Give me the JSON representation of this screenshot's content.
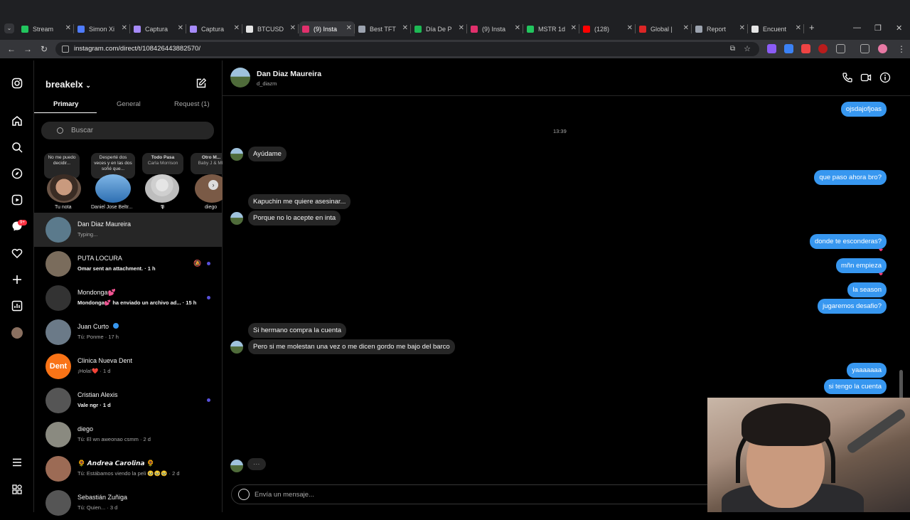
{
  "browser": {
    "tabs": [
      {
        "title": "Stream",
        "color": "#22c55e"
      },
      {
        "title": "Simon Xi",
        "color": "#4f7cff"
      },
      {
        "title": "Captura",
        "color": "#a78bfa"
      },
      {
        "title": "Captura",
        "color": "#a78bfa"
      },
      {
        "title": "BTCUSD",
        "color": "#e5e5e5"
      },
      {
        "title": "(9) Insta",
        "color": "#e1306c"
      },
      {
        "title": "Best TFT",
        "color": "#9ca3af"
      },
      {
        "title": "Día De P",
        "color": "#1db954"
      },
      {
        "title": "(9) Insta",
        "color": "#e1306c"
      },
      {
        "title": "MSTR 1d",
        "color": "#22c55e"
      },
      {
        "title": "(128)",
        "color": "#ff0000"
      },
      {
        "title": "Global |",
        "color": "#dc2626"
      },
      {
        "title": "Report",
        "color": "#9ca3af"
      },
      {
        "title": "Encuent",
        "color": "#e5e5e5"
      }
    ],
    "url": "instagram.com/direct/t/108426443882570/"
  },
  "sidebar": {
    "account": "breakelx",
    "tabs": [
      "Primary",
      "General",
      "Request (1)"
    ],
    "search_placeholder": "Buscar",
    "notes": [
      {
        "bubble": "No me puedo decidir...",
        "label": "Tu nota"
      },
      {
        "bubble": "Desperté dos veces y en las dos soñé que...",
        "label": "Daniel Jose Beltr..."
      },
      {
        "bubble": "Todo Pasa",
        "bubble_sub": "Carla Morrison",
        "label": "𝕻"
      },
      {
        "bubble": "Otro M...",
        "bubble_sub": "Baby J & ML",
        "label": "diego"
      }
    ],
    "conversations": [
      {
        "name": "Dan Diaz Maureira",
        "sub": "Typing...",
        "selected": true,
        "unread": false,
        "color": "#5b7a8c"
      },
      {
        "name": "PUTA LOCURA",
        "sub": "Omar sent an attachment. · 1 h",
        "bold": true,
        "unread": true,
        "muted": true,
        "color": "#7a6c5c"
      },
      {
        "name": "Mondonga💕",
        "sub": "Mondonga💕 ha enviado un archivo ad... · 15 h",
        "bold": true,
        "unread": true,
        "color": "#333"
      },
      {
        "name": "Juan Curto",
        "sub": "Tú: Ponme · 17 h",
        "verified": true,
        "color": "#6b7a88"
      },
      {
        "name": "Clinica Nueva Dent",
        "sub": "¡Hola!❤️ · 1 d",
        "color": "#f97316",
        "logo": "dent"
      },
      {
        "name": "Cristian Alexis",
        "sub": "Vale ngr · 1 d",
        "bold": true,
        "unread": true,
        "color": "#555"
      },
      {
        "name": "diego",
        "sub": "Tú: El wn aweonao csmm · 2 d",
        "color": "#8a8a80"
      },
      {
        "name": "🌻 𝘼𝙣𝙙𝙧𝙚𝙖 𝘾𝙖𝙧𝙤𝙡𝙞𝙣𝙖 🌻",
        "sub": "Tú: Estábamos viendo la peli 🥹🥹🥹 · 2 d",
        "color": "#9c6b55"
      },
      {
        "name": "Sebastián Zuñiga",
        "sub": "Tú: Quien... · 3 d",
        "color": "#555"
      }
    ]
  },
  "chat": {
    "name": "Dan Diaz Maureira",
    "username": "d_diazm",
    "timestamp": "13:39",
    "messages": [
      {
        "dir": "out",
        "text": "ojsdajofjoas"
      },
      {
        "dir": "in",
        "text": "Ayúdame"
      },
      {
        "dir": "out",
        "text": "que paso ahora bro?"
      },
      {
        "dir": "in",
        "text": "Kapuchin me quiere asesinar..."
      },
      {
        "dir": "in",
        "text": "Porque no lo acepte en inta"
      },
      {
        "dir": "out",
        "text": "donde te esconderas?",
        "react": "❤"
      },
      {
        "dir": "out",
        "text": "mñn empieza",
        "react": "❤"
      },
      {
        "dir": "out",
        "text": "la season"
      },
      {
        "dir": "out",
        "text": "jugaremos desafio?"
      },
      {
        "dir": "in",
        "text": "Si hermano compra la cuenta"
      },
      {
        "dir": "in",
        "text": "Pero si me molestan una vez o me dicen gordo me bajo del barco"
      },
      {
        "dir": "out",
        "text": "yaaaaaaa"
      },
      {
        "dir": "out",
        "text": "si tengo la cuenta"
      }
    ],
    "typing_indicator": "···",
    "composer_placeholder": "Envía un mensaje..."
  }
}
